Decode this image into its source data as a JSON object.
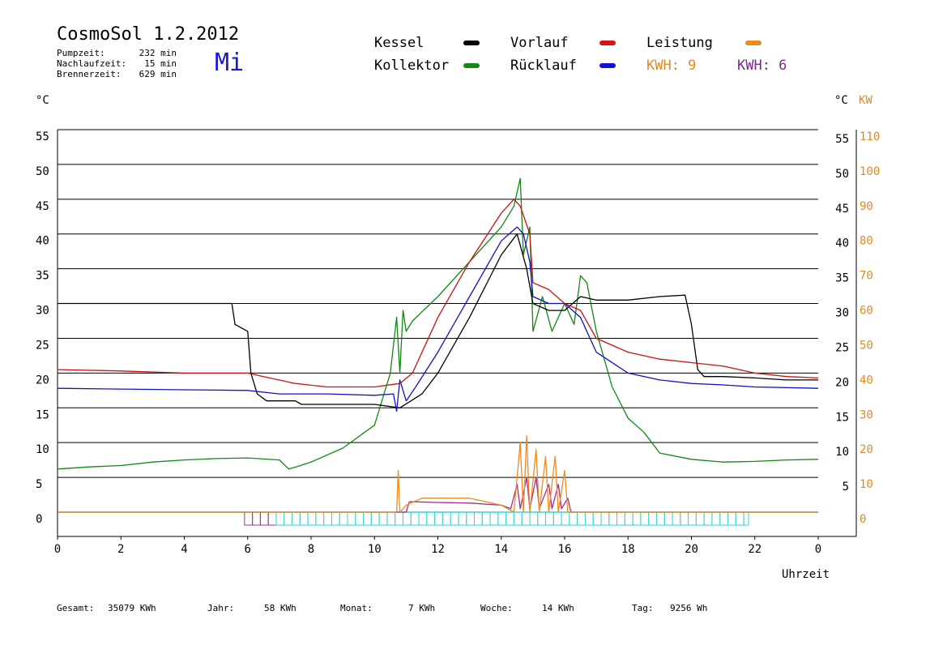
{
  "header": {
    "title": "CosmoSol 1.2.2012",
    "day": "Mi",
    "stats": [
      {
        "label": "Pumpzeit:",
        "value": "232 min"
      },
      {
        "label": "Nachlaufzeit:",
        "value": "15 min"
      },
      {
        "label": "Brennerzeit:",
        "value": "629 min"
      }
    ]
  },
  "legend": {
    "kessel": "Kessel",
    "vorlauf": "Vorlauf",
    "leistung": "Leistung",
    "kollektor": "Kollektor",
    "ruecklauf": "Rücklauf",
    "kwh1": "KWH: 9",
    "kwh2": "KWH: 6"
  },
  "colors": {
    "kessel": "#000000",
    "vorlauf": "#cc1111",
    "leistung": "#ee8a1e",
    "kollektor": "#118811",
    "ruecklauf": "#1111cc",
    "kwh2": "#7a2a8a",
    "cyan": "#33d6d6",
    "magenta": "#a0308a"
  },
  "footer": [
    {
      "label": "Gesamt:",
      "value": "35079 KWh"
    },
    {
      "label": "Jahr:",
      "value": "58 KWh"
    },
    {
      "label": "Monat:",
      "value": "7 KWh"
    },
    {
      "label": "Woche:",
      "value": "14 KWh"
    },
    {
      "label": "Tag:",
      "value": "9256 Wh"
    }
  ],
  "chart_data": {
    "type": "line",
    "title": "CosmoSol 1.2.2012",
    "xlabel": "Uhrzeit",
    "ylabel_left": "°C",
    "ylabel_right": "°C",
    "ylabel_right2": "KW",
    "xlim": [
      0,
      24
    ],
    "ylim": [
      0,
      55
    ],
    "y2lim": [
      0,
      110
    ],
    "x_ticks": [
      "0",
      "2",
      "4",
      "6",
      "8",
      "10",
      "12",
      "14",
      "16",
      "18",
      "20",
      "22",
      "0"
    ],
    "y_ticks": [
      "0",
      "5",
      "10",
      "15",
      "20",
      "25",
      "30",
      "35",
      "40",
      "45",
      "50",
      "55"
    ],
    "y2_ticks": [
      "0",
      "10",
      "20",
      "30",
      "40",
      "50",
      "60",
      "70",
      "80",
      "90",
      "100",
      "110"
    ],
    "grid": true,
    "series": [
      {
        "name": "Kessel",
        "key": "kessel",
        "points": [
          [
            0,
            30
          ],
          [
            1,
            30
          ],
          [
            3,
            30
          ],
          [
            5.5,
            30
          ],
          [
            5.6,
            27
          ],
          [
            6,
            26
          ],
          [
            6.1,
            20
          ],
          [
            6.3,
            17
          ],
          [
            6.6,
            16
          ],
          [
            7.5,
            16
          ],
          [
            7.7,
            15.5
          ],
          [
            9,
            15.5
          ],
          [
            10,
            15.5
          ],
          [
            10.8,
            15
          ],
          [
            11.5,
            17
          ],
          [
            12,
            20
          ],
          [
            13,
            28
          ],
          [
            14,
            37
          ],
          [
            14.5,
            40
          ],
          [
            14.8,
            35
          ],
          [
            15,
            30
          ],
          [
            15.5,
            29
          ],
          [
            16,
            29
          ],
          [
            16.5,
            31
          ],
          [
            17,
            30.5
          ],
          [
            18,
            30.5
          ],
          [
            19,
            31
          ],
          [
            19.8,
            31.2
          ],
          [
            20,
            27
          ],
          [
            20.2,
            20.5
          ],
          [
            20.4,
            19.5
          ],
          [
            21,
            19.5
          ],
          [
            22,
            19.3
          ],
          [
            23,
            19
          ],
          [
            24,
            19
          ]
        ]
      },
      {
        "name": "Vorlauf",
        "key": "vorlauf",
        "points": [
          [
            0,
            20.5
          ],
          [
            2,
            20.3
          ],
          [
            4,
            20
          ],
          [
            6,
            20
          ],
          [
            6.5,
            19.5
          ],
          [
            7.5,
            18.5
          ],
          [
            8.5,
            18
          ],
          [
            10,
            18
          ],
          [
            10.8,
            18.5
          ],
          [
            11.2,
            20
          ],
          [
            12,
            28
          ],
          [
            13,
            36
          ],
          [
            14,
            43
          ],
          [
            14.4,
            45
          ],
          [
            14.6,
            44
          ],
          [
            14.9,
            40
          ],
          [
            15,
            33
          ],
          [
            15.5,
            32
          ],
          [
            16,
            30
          ],
          [
            16.5,
            29
          ],
          [
            17,
            25
          ],
          [
            18,
            23
          ],
          [
            19,
            22
          ],
          [
            20,
            21.5
          ],
          [
            21,
            21
          ],
          [
            22,
            20
          ],
          [
            23,
            19.5
          ],
          [
            24,
            19.3
          ]
        ]
      },
      {
        "name": "Rücklauf",
        "key": "ruecklauf",
        "points": [
          [
            0,
            17.8
          ],
          [
            2,
            17.7
          ],
          [
            4,
            17.6
          ],
          [
            6,
            17.5
          ],
          [
            7,
            17
          ],
          [
            8.5,
            17
          ],
          [
            10,
            16.8
          ],
          [
            10.6,
            17
          ],
          [
            10.7,
            14.5
          ],
          [
            10.8,
            19
          ],
          [
            11,
            16
          ],
          [
            11.3,
            18
          ],
          [
            12,
            23
          ],
          [
            13,
            31
          ],
          [
            14,
            39
          ],
          [
            14.5,
            41
          ],
          [
            14.7,
            40
          ],
          [
            14.9,
            36
          ],
          [
            15,
            31
          ],
          [
            15.5,
            30
          ],
          [
            16,
            30
          ],
          [
            16.5,
            28
          ],
          [
            17,
            23
          ],
          [
            18,
            20
          ],
          [
            19,
            19
          ],
          [
            20,
            18.5
          ],
          [
            21,
            18.3
          ],
          [
            22,
            18
          ],
          [
            24,
            17.8
          ]
        ]
      },
      {
        "name": "Kollektor",
        "key": "kollektor",
        "points": [
          [
            0,
            6.2
          ],
          [
            1,
            6.5
          ],
          [
            2,
            6.7
          ],
          [
            3,
            7.2
          ],
          [
            4,
            7.5
          ],
          [
            5,
            7.7
          ],
          [
            6,
            7.8
          ],
          [
            7,
            7.5
          ],
          [
            7.3,
            6.2
          ],
          [
            7.6,
            6.6
          ],
          [
            8,
            7.2
          ],
          [
            9,
            9.2
          ],
          [
            10,
            12.5
          ],
          [
            10.5,
            20
          ],
          [
            10.7,
            28
          ],
          [
            10.8,
            20
          ],
          [
            10.9,
            29
          ],
          [
            11,
            26
          ],
          [
            11.2,
            27.5
          ],
          [
            12,
            31
          ],
          [
            13,
            36
          ],
          [
            14,
            41
          ],
          [
            14.4,
            44
          ],
          [
            14.6,
            48
          ],
          [
            14.7,
            37
          ],
          [
            14.9,
            41
          ],
          [
            15,
            26
          ],
          [
            15.3,
            31
          ],
          [
            15.6,
            26
          ],
          [
            16,
            30
          ],
          [
            16.3,
            27
          ],
          [
            16.5,
            34
          ],
          [
            16.7,
            33
          ],
          [
            17,
            26
          ],
          [
            17.5,
            18
          ],
          [
            18,
            13.5
          ],
          [
            18.5,
            11.5
          ],
          [
            19,
            8.5
          ],
          [
            20,
            7.6
          ],
          [
            21,
            7.2
          ],
          [
            22,
            7.3
          ],
          [
            23,
            7.5
          ],
          [
            24,
            7.6
          ]
        ]
      },
      {
        "name": "Leistung",
        "key": "leistung",
        "points": [
          [
            0,
            0
          ],
          [
            10.7,
            0
          ],
          [
            10.75,
            6
          ],
          [
            10.8,
            0
          ],
          [
            11,
            1
          ],
          [
            11.5,
            2
          ],
          [
            12,
            2
          ],
          [
            13,
            2
          ],
          [
            14,
            1
          ],
          [
            14.4,
            0
          ],
          [
            14.6,
            10
          ],
          [
            14.7,
            0
          ],
          [
            14.8,
            11
          ],
          [
            14.9,
            0
          ],
          [
            15.1,
            9
          ],
          [
            15.2,
            0
          ],
          [
            15.4,
            8
          ],
          [
            15.5,
            0
          ],
          [
            15.7,
            8
          ],
          [
            15.8,
            0
          ],
          [
            16,
            6
          ],
          [
            16.1,
            0
          ],
          [
            24,
            0
          ]
        ]
      },
      {
        "name": "",
        "key": "magenta",
        "points": [
          [
            0,
            0
          ],
          [
            11,
            0
          ],
          [
            11.1,
            1.5
          ],
          [
            12,
            1.4
          ],
          [
            13,
            1.3
          ],
          [
            14,
            1
          ],
          [
            14.3,
            0.5
          ],
          [
            14.5,
            4
          ],
          [
            14.6,
            0.5
          ],
          [
            14.8,
            5
          ],
          [
            14.9,
            0.5
          ],
          [
            15.1,
            5
          ],
          [
            15.2,
            0.5
          ],
          [
            15.5,
            4
          ],
          [
            15.6,
            0.5
          ],
          [
            15.8,
            4
          ],
          [
            15.9,
            0.5
          ],
          [
            16.1,
            2
          ],
          [
            16.2,
            0
          ],
          [
            24,
            0
          ]
        ]
      }
    ],
    "pump_band": {
      "x_start": 5.9,
      "x_end": 21.8
    }
  },
  "axis_units": {
    "left": "°C",
    "right": "°C",
    "right_kw": "KW",
    "x": "Uhrzeit"
  }
}
